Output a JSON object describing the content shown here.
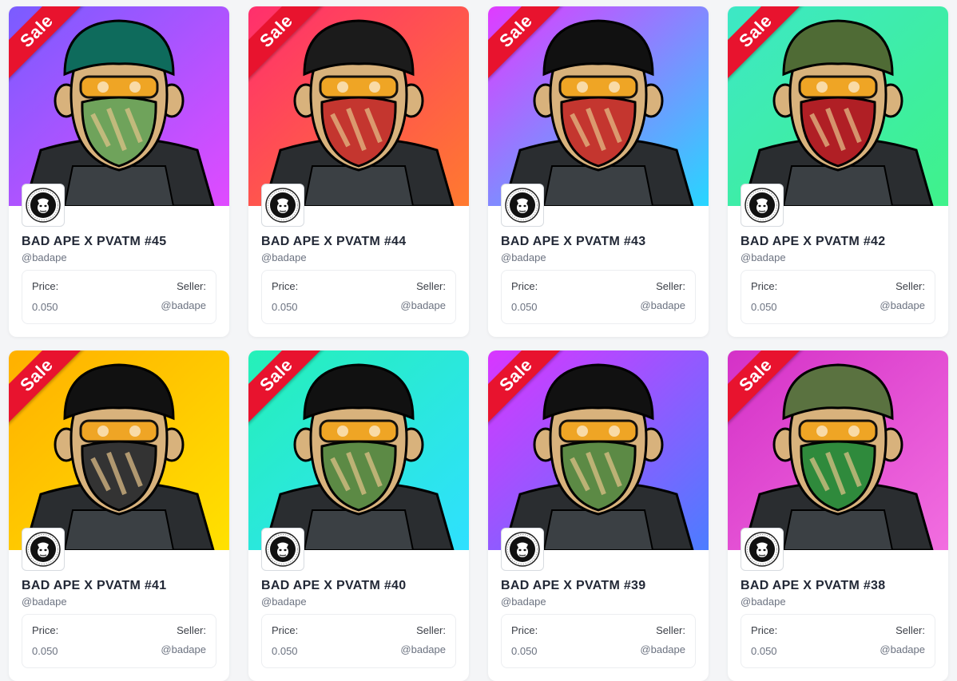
{
  "cards": [
    {
      "badge": "Sale",
      "title": "BAD APE X PVATM #45",
      "handle": "@badape",
      "price_label": "Price:",
      "price": "0.050",
      "seller_label": "Seller:",
      "seller": "@badape",
      "bg1": "#7a5cff",
      "bg2": "#e04bff",
      "helmet": "#0e6b5c",
      "mask": "#6fa35b"
    },
    {
      "badge": "Sale",
      "title": "BAD APE X PVATM #44",
      "handle": "@badape",
      "price_label": "Price:",
      "price": "0.050",
      "seller_label": "Seller:",
      "seller": "@badape",
      "bg1": "#ff2f6d",
      "bg2": "#ff7a2f",
      "helmet": "#1b1b1b",
      "mask": "#c4362f"
    },
    {
      "badge": "Sale",
      "title": "BAD APE X PVATM #43",
      "handle": "@badape",
      "price_label": "Price:",
      "price": "0.050",
      "seller_label": "Seller:",
      "seller": "@badape",
      "bg1": "#e03bff",
      "bg2": "#27d6ff",
      "helmet": "#111111",
      "mask": "#c4362f"
    },
    {
      "badge": "Sale",
      "title": "BAD APE X PVATM #42",
      "handle": "@badape",
      "price_label": "Price:",
      "price": "0.050",
      "seller_label": "Seller:",
      "seller": "@badape",
      "bg1": "#3de8c6",
      "bg2": "#3ff28a",
      "helmet": "#4f6b35",
      "mask": "#b01f25"
    },
    {
      "badge": "Sale",
      "title": "BAD APE X PVATM #41",
      "handle": "@badape",
      "price_label": "Price:",
      "price": "0.050",
      "seller_label": "Seller:",
      "seller": "@badape",
      "bg1": "#ffb000",
      "bg2": "#ffe100",
      "helmet": "#111111",
      "mask": "#333333"
    },
    {
      "badge": "Sale",
      "title": "BAD APE X PVATM #40",
      "handle": "@badape",
      "price_label": "Price:",
      "price": "0.050",
      "seller_label": "Seller:",
      "seller": "@badape",
      "bg1": "#25f0b8",
      "bg2": "#2fe0ff",
      "helmet": "#111111",
      "mask": "#5c8a45"
    },
    {
      "badge": "Sale",
      "title": "BAD APE X PVATM #39",
      "handle": "@badape",
      "price_label": "Price:",
      "price": "0.050",
      "seller_label": "Seller:",
      "seller": "@badape",
      "bg1": "#d936ff",
      "bg2": "#4b7dff",
      "helmet": "#111111",
      "mask": "#5c8a45"
    },
    {
      "badge": "Sale",
      "title": "BAD APE X PVATM #38",
      "handle": "@badape",
      "price_label": "Price:",
      "price": "0.050",
      "seller_label": "Seller:",
      "seller": "@badape",
      "bg1": "#d431c7",
      "bg2": "#f26ee0",
      "helmet": "#5a7240",
      "mask": "#2f8a3c"
    }
  ]
}
